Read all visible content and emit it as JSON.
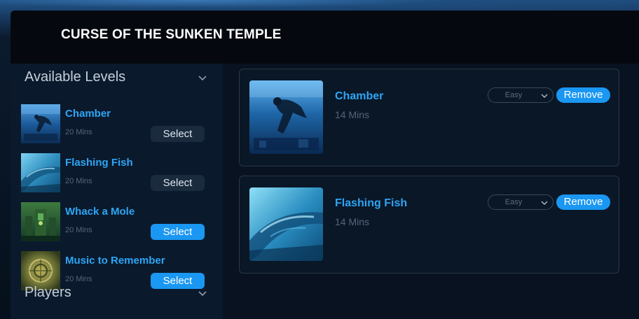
{
  "window": {
    "title": "CURSE OF THE SUNKEN TEMPLE"
  },
  "sidebar": {
    "available_levels_label": "Available Levels",
    "players_label": "Players",
    "levels": [
      {
        "name": "Chamber",
        "duration": "20 Mins",
        "button": "Select",
        "selected": false,
        "thumb": "diver-thumbnail"
      },
      {
        "name": "Flashing Fish",
        "duration": "20 Mins",
        "button": "Select",
        "selected": false,
        "thumb": "fish-thumbnail"
      },
      {
        "name": "Whack a Mole",
        "duration": "20 Mins",
        "button": "Select",
        "selected": true,
        "thumb": "ruins-thumbnail"
      },
      {
        "name": "Music to Remember",
        "duration": "20 Mins",
        "button": "Select",
        "selected": true,
        "thumb": "carving-thumbnail"
      }
    ]
  },
  "selected_levels": [
    {
      "name": "Chamber",
      "duration": "14 Mins",
      "difficulty": "Easy",
      "remove_label": "Remove",
      "thumb": "diver-thumbnail"
    },
    {
      "name": "Flashing Fish",
      "duration": "14 Mins",
      "difficulty": "Easy",
      "remove_label": "Remove",
      "thumb": "fish-thumbnail"
    }
  ],
  "colors": {
    "accent": "#1a97f2",
    "link": "#2ea5f5",
    "background": "#081220",
    "sidebar": "#0a1a2c"
  }
}
